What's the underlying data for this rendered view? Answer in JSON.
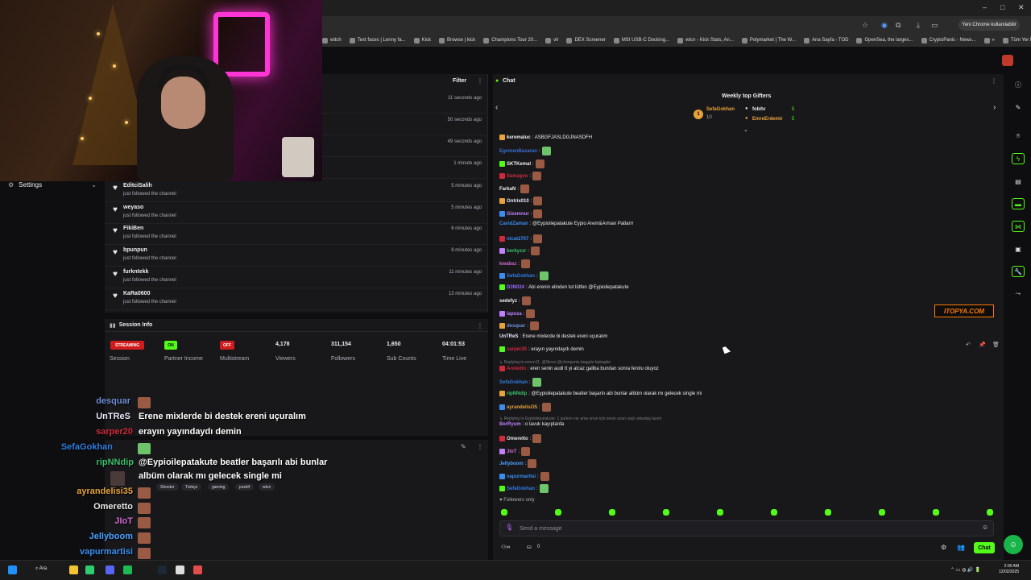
{
  "browser": {
    "bookmarks": [
      "witch",
      "Text faces | Lenny fa...",
      "Kick",
      "Browse | kick",
      "Champions Tour 20...",
      "vlr",
      "DEX Screener",
      "MSI USB-C Docking...",
      "wtcn - Kick Stats, An...",
      "Polymarket | The W...",
      "Ana Sayfa - TOD",
      "OpenSea, the larges...",
      "CryptoPanic - News...",
      "»",
      "Tüm Yer İşaretleri"
    ],
    "profile_button": "Yeni Chrome kullanılabilir"
  },
  "left": {
    "settings_label": "Settings"
  },
  "feed": {
    "filter_label": "Filter",
    "blank_times": [
      "11 seconds ago",
      "50 seconds ago",
      "49 seconds ago",
      "1 minute ago"
    ],
    "rows": [
      {
        "name": "EditciSalih",
        "sub": "just followed the channel",
        "time": "5 minutes ago"
      },
      {
        "name": "weyaso",
        "sub": "just followed the channel",
        "time": "5 minutes ago"
      },
      {
        "name": "FikiBen",
        "sub": "just followed the channel",
        "time": "6 minutes ago"
      },
      {
        "name": "bpunpun",
        "sub": "just followed the channel",
        "time": "8 minutes ago"
      },
      {
        "name": "furkntekk",
        "sub": "just followed the channel",
        "time": "11 minutes ago"
      },
      {
        "name": "KaRa0600",
        "sub": "just followed the channel",
        "time": "13 minutes ago"
      }
    ]
  },
  "session": {
    "title": "Session Info",
    "badges": {
      "streaming": "STREAMING",
      "on": "ON",
      "off": "OFF"
    },
    "labels": {
      "session": "Session",
      "partner": "Partner Income",
      "multistream": "Multistream"
    },
    "stats": [
      {
        "value": "4,178",
        "label": "Viewers"
      },
      {
        "value": "311,154",
        "label": "Followers"
      },
      {
        "value": "1,650",
        "label": "Sub Counts"
      },
      {
        "value": "04:01:53",
        "label": "Time Live"
      }
    ]
  },
  "stream_info": {
    "tags": [
      "Shooter",
      "Türkçe",
      "gaming",
      "pozitif",
      "wtcn"
    ]
  },
  "overlay_chat": [
    {
      "user": "desquar",
      "color": "#6d8fd6",
      "msg": ""
    },
    {
      "user": "UnTReS",
      "color": "#e9e9ff",
      "msg": "Erene mixlerde bi destek ereni uçuralım"
    },
    {
      "user": "sarper20",
      "color": "#d02a3a",
      "msg": "erayın yayındaydı demin"
    },
    {
      "user": "SefaGokhan",
      "color": "#2f7ce0",
      "msg": ""
    },
    {
      "user": "ripNNdip",
      "color": "#39c06a",
      "msg": "@Eypioilepatakute beatler başarılı abi bunlar"
    },
    {
      "user": "",
      "color": "#fff",
      "msg": "albüm olarak mı gelecek single mi"
    },
    {
      "user": "ayrandelisi35",
      "color": "#e2a23c",
      "msg": ""
    },
    {
      "user": "Omeretto",
      "color": "#e6e6e6",
      "msg": ""
    },
    {
      "user": "JIoT",
      "color": "#d06ad0",
      "msg": ""
    },
    {
      "user": "Jellyboom",
      "color": "#4aa0ff",
      "msg": ""
    },
    {
      "user": "vapurmartisi",
      "color": "#3a8ef0",
      "msg": ""
    },
    {
      "user": "SefaGokhan",
      "color": "#2f7ce0",
      "msg": ""
    }
  ],
  "chat": {
    "title": "Chat",
    "gifters_title": "Weekly top Gifters",
    "gifters": [
      {
        "rank": "1",
        "name": "SefaGokhan",
        "count": "10",
        "color": "#e8a33a"
      },
      {
        "rank": "",
        "name": "fobitv",
        "count": "5",
        "color": "#efeff1"
      },
      {
        "rank": "",
        "name": "EmreErdemir",
        "count": "5",
        "color": "#e8a33a"
      }
    ],
    "messages": [
      {
        "user": "keremaluc",
        "color": "#efeff1",
        "text": ": ASBGFJASLDGJNASDFH"
      },
      {
        "user": "EgemenBasaran",
        "color": "#3a6fd0",
        "text": ":"
      },
      {
        "user": "SKTKemal",
        "color": "#efeff1",
        "text": ":"
      },
      {
        "user": "Samzgvo",
        "color": "#d02a3a",
        "text": ":"
      },
      {
        "user": "FarkaN",
        "color": "#efeff1",
        "text": ":"
      },
      {
        "user": "Ontrix010",
        "color": "#e9e9ff",
        "text": ":"
      },
      {
        "user": "Gizemnur",
        "color": "#c080ff",
        "text": ":"
      },
      {
        "user": "CavidZaman",
        "color": "#3a8ef0",
        "text": ": @Eypioilepatakute Eypio Arem&Arman Patlarrr"
      },
      {
        "user": "nicat2707",
        "color": "#3a8ef0",
        "text": ":"
      },
      {
        "user": "berkyzzr",
        "color": "#39c06a",
        "text": ":"
      },
      {
        "user": "kwabsz",
        "color": "#d06ad0",
        "text": ":"
      },
      {
        "user": "SefaGokhan",
        "color": "#2f7ce0",
        "text": ":"
      },
      {
        "user": "D3N024",
        "color": "#9b6bff",
        "text": ": Abi erenin elinden tut lütfen @Eypioilepatakute"
      },
      {
        "user": "sedefyz",
        "color": "#efeff1",
        "text": ":"
      },
      {
        "user": "lapoza",
        "color": "#c080ff",
        "text": ":"
      },
      {
        "user": "desquar",
        "color": "#6d8fd6",
        "text": ":"
      },
      {
        "user": "UnTReS",
        "color": "#e9e9ff",
        "text": ": Erene mixlerde bi destek ereni uçuralım"
      },
      {
        "user": "sarper20",
        "color": "#d02a3a",
        "text": ": erayın yayındaydı demin"
      },
      {
        "user": "Arxledin",
        "color": "#d02a3a",
        "text": ": eren senin audi tt yi alcaz galiba bundan sonra ferolu oluyoz",
        "reply": "Replying to erenn11: @Sinoo @chimpynts beggöz babagler"
      },
      {
        "user": "SefaGokhan",
        "color": "#2f7ce0",
        "text": ":"
      },
      {
        "user": "ripNNdip",
        "color": "#39c06a",
        "text": ": @Eypioilepatakute beatler başarılı abi bunlar albüm olarak mı gelecek single mi"
      },
      {
        "user": "ayrandelisi35",
        "color": "#e2a23c",
        "text": ":"
      },
      {
        "user": "BerRyum",
        "color": "#c080ff",
        "text": ": o lavuk kayıplarda",
        "reply": "Replying to Eypioilepatakute: 1 şarkım var ama onun için senin uzun saçlı arkadaş lazım"
      },
      {
        "user": "Omeretto",
        "color": "#e6e6e6",
        "text": ":"
      },
      {
        "user": "JIoT",
        "color": "#d06ad0",
        "text": ":"
      },
      {
        "user": "Jellyboom",
        "color": "#4aa0ff",
        "text": ":"
      },
      {
        "user": "vapurmartisi",
        "color": "#3a8ef0",
        "text": ":"
      },
      {
        "user": "SefaGokhan",
        "color": "#2f7ce0",
        "text": ":"
      }
    ],
    "followers_only": "Followers only",
    "send_placeholder": "Send a message",
    "bottom_counts": [
      "0",
      "0"
    ],
    "chat_button": "Chat",
    "overlay_brand": "ITOPYA.COM"
  },
  "taskbar": {
    "search": "Ara",
    "time": "2:00 AM",
    "date": "12/02/2025"
  },
  "colors": {
    "kick_green": "#53fc18",
    "panel": "#18181b",
    "bg": "#0e0e10"
  }
}
